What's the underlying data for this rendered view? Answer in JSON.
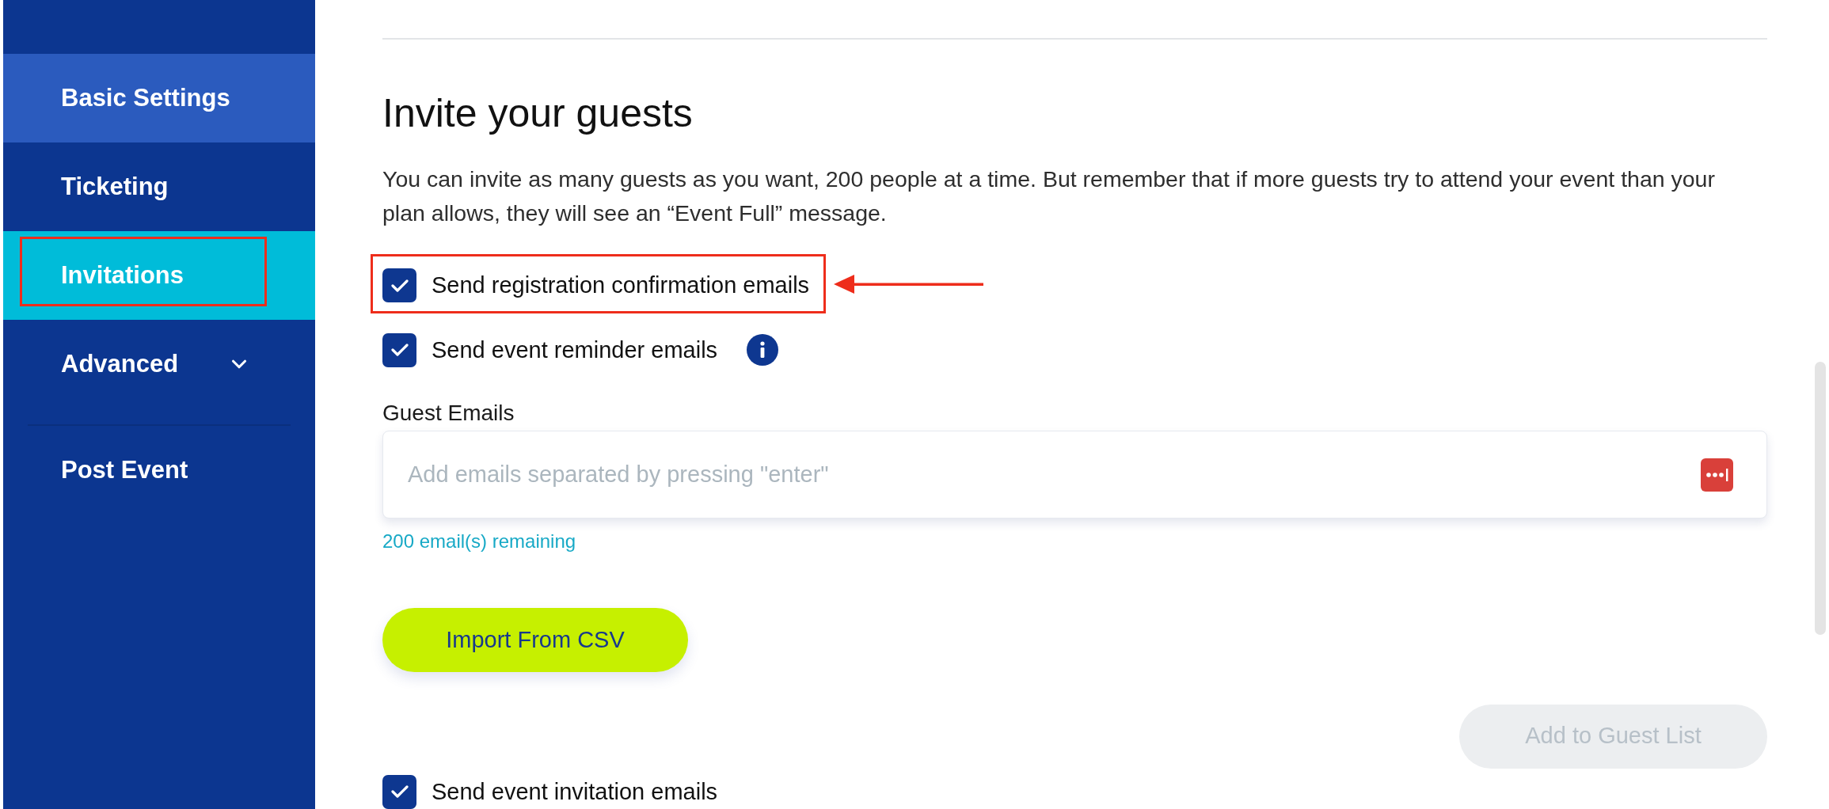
{
  "sidebar": {
    "items": [
      {
        "label": "Basic Settings",
        "kind": "link",
        "selected": false,
        "hovered": true,
        "annotated": false
      },
      {
        "label": "Ticketing",
        "kind": "link",
        "selected": false,
        "hovered": false,
        "annotated": false
      },
      {
        "label": "Invitations",
        "kind": "link",
        "selected": true,
        "hovered": false,
        "annotated": true
      },
      {
        "label": "Advanced",
        "kind": "group",
        "selected": false,
        "hovered": false,
        "annotated": false,
        "expanded": false
      }
    ],
    "bottom_items": [
      {
        "label": "Post Event",
        "kind": "link",
        "selected": false,
        "hovered": false,
        "annotated": false
      }
    ]
  },
  "section": {
    "title": "Invite your guests",
    "description": "You can invite as many guests as you want, 200 people at a time. But remember that if more guests try to attend your event than your plan allows, they will see an “Event Full” message.",
    "options": [
      {
        "label": "Send registration confirmation emails",
        "checked": true,
        "info": false,
        "annotated": true,
        "arrow": true
      },
      {
        "label": "Send event reminder emails",
        "checked": true,
        "info": true,
        "annotated": false,
        "arrow": false
      }
    ],
    "guest_emails": {
      "label": "Guest Emails",
      "placeholder": "Add emails separated by pressing \"enter\"",
      "remaining": "200 email(s) remaining"
    },
    "import_button": {
      "label": "Import From CSV"
    },
    "add_button": {
      "label": "Add to Guest List",
      "disabled": true
    },
    "invitation_option": {
      "label": "Send event invitation emails",
      "checked": true
    }
  }
}
